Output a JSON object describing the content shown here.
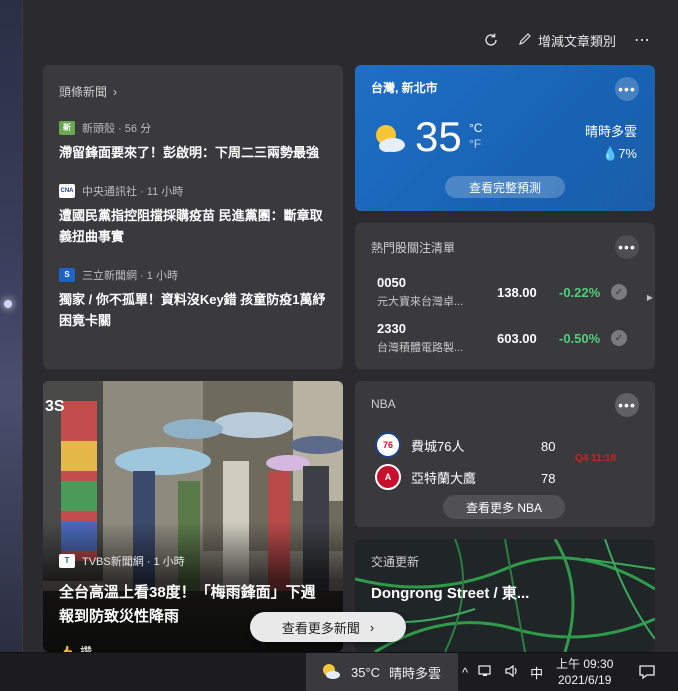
{
  "toolbar": {
    "refresh_icon": "refresh-icon",
    "edit_label": "增減文章類別",
    "more_label": "⋯"
  },
  "headlines": {
    "title": "頭條新聞",
    "items": [
      {
        "source": "新頭殼 · 56 分",
        "logo": "新",
        "logo_color": "#6aa84f",
        "title": "滯留鋒面要來了！彭啟明：下周二三兩勢最強"
      },
      {
        "source": "中央通訊社 · 11 小時",
        "logo": "CNA",
        "logo_color": "#e8e8e8",
        "title": "遭國民黨指控阻擋採購疫苗 民進黨團：斷章取義扭曲事實"
      },
      {
        "source": "三立新聞網 · 1 小時",
        "logo": "S",
        "logo_color": "#1d63c4",
        "title": "獨家 / 你不孤單！資料沒Key錯 孩童防疫1萬紓困竟卡關"
      }
    ]
  },
  "weather": {
    "location": "台灣, 新北市",
    "temperature": "35",
    "unit_c": "°C",
    "unit_f": "°F",
    "condition": "晴時多雲",
    "precip": "7%",
    "forecast_button": "查看完整預測",
    "more": "•••"
  },
  "stocks": {
    "title": "熱門股關注清單",
    "more": "•••",
    "items": [
      {
        "symbol": "0050",
        "name": "元大寶來台灣卓...",
        "price": "138.00",
        "change": "-0.22%"
      },
      {
        "symbol": "2330",
        "name": "台灣積體電路製...",
        "price": "603.00",
        "change": "-0.50%"
      }
    ]
  },
  "nba": {
    "title": "NBA",
    "more": "•••",
    "teams": [
      {
        "name": "費城76人",
        "score": "80",
        "logo_bg": "#1d428a"
      },
      {
        "name": "亞特蘭大鷹",
        "score": "78",
        "logo_bg": "#c8102e"
      }
    ],
    "game_time": "Q4 11:18",
    "more_button": "查看更多 NBA"
  },
  "traffic": {
    "title": "交通更新",
    "street": "Dongrong Street / 東..."
  },
  "photo_news": {
    "source": "TVBS新聞網 · 1 小時",
    "headline": "全台高溫上看38度！「梅雨鋒面」下週報到防致災性降雨",
    "like_label": "讚"
  },
  "more_news_button": "查看更多新聞",
  "taskbar": {
    "weather_temp": "35°C",
    "weather_cond": "晴時多雲",
    "ime": "中",
    "time": "上午 09:30",
    "date": "2021/6/19"
  },
  "colors": {
    "panel_bg": "#2b2b2f",
    "card_bg": "#3a3a3d",
    "weather_blue": "#1863b4",
    "stock_green": "#4fcf7a",
    "game_red": "#d02020"
  }
}
